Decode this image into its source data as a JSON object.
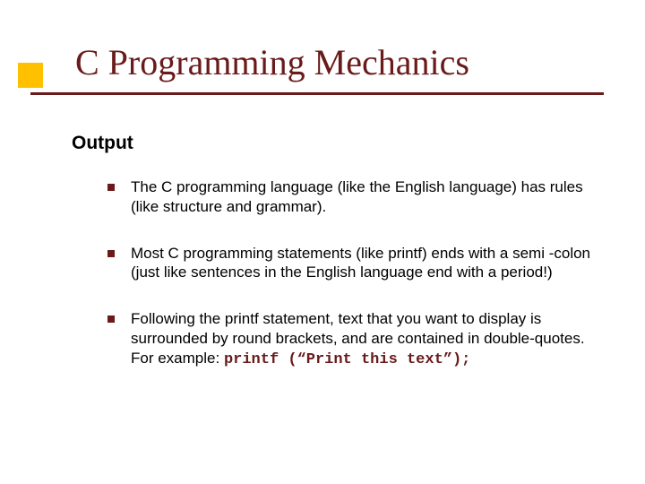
{
  "title": "C Programming Mechanics",
  "section": "Output",
  "bullets": [
    "The C programming language (like the English language) has rules (like structure and grammar).",
    "Most C programming statements (like printf) ends with a semi -colon (just like sentences in the English language end with a period!)",
    {
      "lead": "Following the printf statement, text that you want to display is surrounded by round brackets, and are contained in double-quotes.  For example: ",
      "code": "printf (“Print this text”);"
    }
  ],
  "colors": {
    "accent": "#6a1a1a",
    "square": "#ffc000"
  }
}
